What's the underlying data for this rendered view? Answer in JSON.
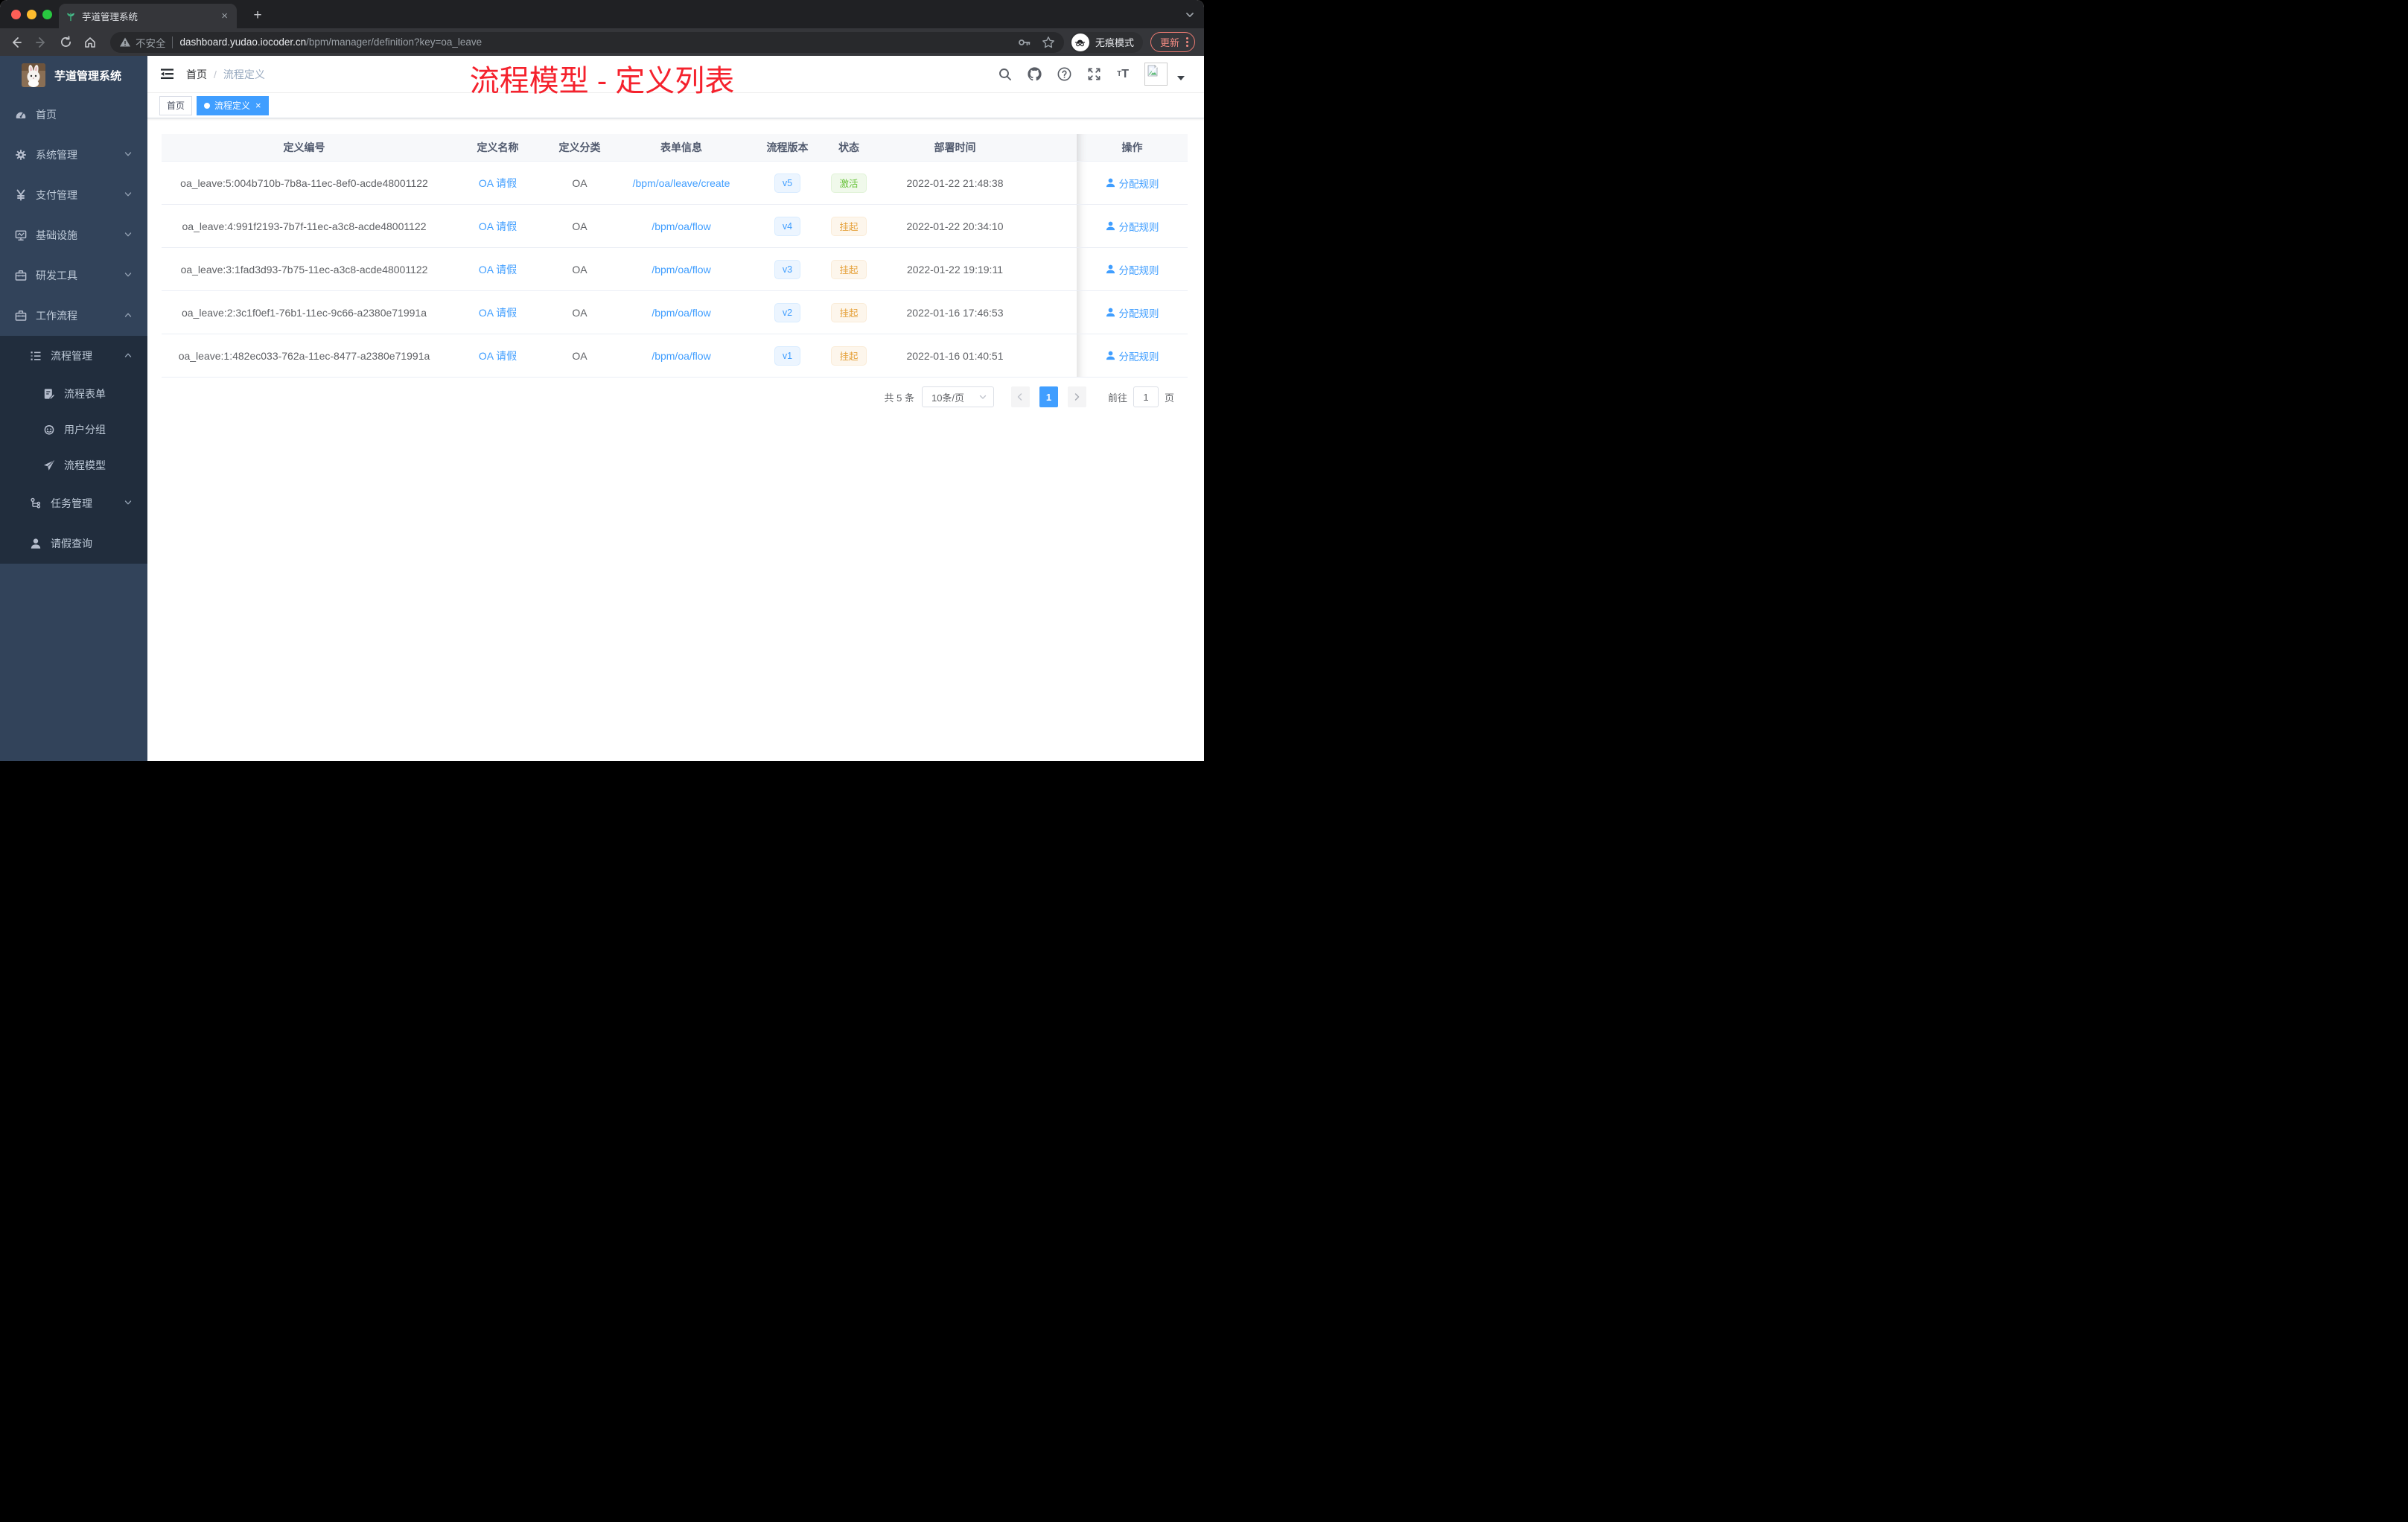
{
  "browser": {
    "tab_title": "芋道管理系统",
    "new_tab_label": "+",
    "close_tab_label": "×",
    "address": {
      "security_label": "不安全",
      "host": "dashboard.yudao.iocoder.cn",
      "path": "/bpm/manager/definition?key=oa_leave"
    },
    "incognito_label": "无痕模式",
    "update_label": "更新"
  },
  "annotation": {
    "title": "流程模型 - 定义列表",
    "color": "#f5222d"
  },
  "app": {
    "logo_title": "芋道管理系统",
    "breadcrumb": {
      "root": "首页",
      "separator": "/",
      "current": "流程定义"
    },
    "tags": [
      {
        "key": "home",
        "label": "首页",
        "active": false,
        "closable": false
      },
      {
        "key": "process-definition",
        "label": "流程定义",
        "active": true,
        "closable": true
      }
    ]
  },
  "sidebar": {
    "items": [
      {
        "key": "home",
        "label": "首页",
        "icon": "dashboard-icon",
        "level": 1,
        "arrow": "",
        "submenu": false
      },
      {
        "key": "system",
        "label": "系统管理",
        "icon": "gear-icon",
        "level": 1,
        "arrow": "down",
        "submenu": false
      },
      {
        "key": "payment",
        "label": "支付管理",
        "icon": "yen-icon",
        "level": 1,
        "arrow": "down",
        "submenu": false
      },
      {
        "key": "infrastructure",
        "label": "基础设施",
        "icon": "monitor-icon",
        "level": 1,
        "arrow": "down",
        "submenu": false
      },
      {
        "key": "dev-tools",
        "label": "研发工具",
        "icon": "toolbox-icon",
        "level": 1,
        "arrow": "down",
        "submenu": false
      },
      {
        "key": "workflow",
        "label": "工作流程",
        "icon": "toolbox-icon",
        "level": 1,
        "arrow": "up",
        "submenu": false
      },
      {
        "key": "process-management",
        "label": "流程管理",
        "icon": "tree-icon",
        "level": 2,
        "arrow": "up",
        "submenu": true
      },
      {
        "key": "process-form",
        "label": "流程表单",
        "icon": "form-icon",
        "level": 3,
        "arrow": "",
        "submenu": true
      },
      {
        "key": "user-group",
        "label": "用户分组",
        "icon": "users-icon",
        "level": 3,
        "arrow": "",
        "submenu": true
      },
      {
        "key": "process-model",
        "label": "流程模型",
        "icon": "plane-icon",
        "level": 3,
        "arrow": "",
        "submenu": true
      },
      {
        "key": "task-management",
        "label": "任务管理",
        "icon": "tasks-icon",
        "level": 2,
        "arrow": "down",
        "submenu": true
      },
      {
        "key": "leave-query",
        "label": "请假查询",
        "icon": "user-icon",
        "level": 2,
        "arrow": "",
        "submenu": true
      }
    ]
  },
  "table": {
    "columns": [
      "定义编号",
      "定义名称",
      "定义分类",
      "表单信息",
      "流程版本",
      "状态",
      "部署时间",
      "操作"
    ],
    "action_label": "分配规则",
    "rows": [
      {
        "id": "oa_leave:5:004b710b-7b8a-11ec-8ef0-acde48001122",
        "name": "OA 请假",
        "category": "OA",
        "form": "/bpm/oa/leave/create",
        "version": "v5",
        "status": "激活",
        "status_type": "success",
        "deploy_time": "2022-01-22 21:48:38"
      },
      {
        "id": "oa_leave:4:991f2193-7b7f-11ec-a3c8-acde48001122",
        "name": "OA 请假",
        "category": "OA",
        "form": "/bpm/oa/flow",
        "version": "v4",
        "status": "挂起",
        "status_type": "warning",
        "deploy_time": "2022-01-22 20:34:10"
      },
      {
        "id": "oa_leave:3:1fad3d93-7b75-11ec-a3c8-acde48001122",
        "name": "OA 请假",
        "category": "OA",
        "form": "/bpm/oa/flow",
        "version": "v3",
        "status": "挂起",
        "status_type": "warning",
        "deploy_time": "2022-01-22 19:19:11"
      },
      {
        "id": "oa_leave:2:3c1f0ef1-76b1-11ec-9c66-a2380e71991a",
        "name": "OA 请假",
        "category": "OA",
        "form": "/bpm/oa/flow",
        "version": "v2",
        "status": "挂起",
        "status_type": "warning",
        "deploy_time": "2022-01-16 17:46:53"
      },
      {
        "id": "oa_leave:1:482ec033-762a-11ec-8477-a2380e71991a",
        "name": "OA 请假",
        "category": "OA",
        "form": "/bpm/oa/flow",
        "version": "v1",
        "status": "挂起",
        "status_type": "warning",
        "deploy_time": "2022-01-16 01:40:51"
      }
    ]
  },
  "pagination": {
    "total_label": "共 5 条",
    "page_size_label": "10条/页",
    "current_page": "1",
    "goto_label": "前往",
    "goto_value": "1",
    "page_unit_label": "页"
  },
  "colors": {
    "accent_blue": "#409eff",
    "status_active_green": "#67c23a",
    "status_suspend_orange": "#e6a23c",
    "annotation_red": "#f5222d",
    "sidebar_bg": "#32435a",
    "sidebar_submenu_bg": "#212d3d"
  }
}
